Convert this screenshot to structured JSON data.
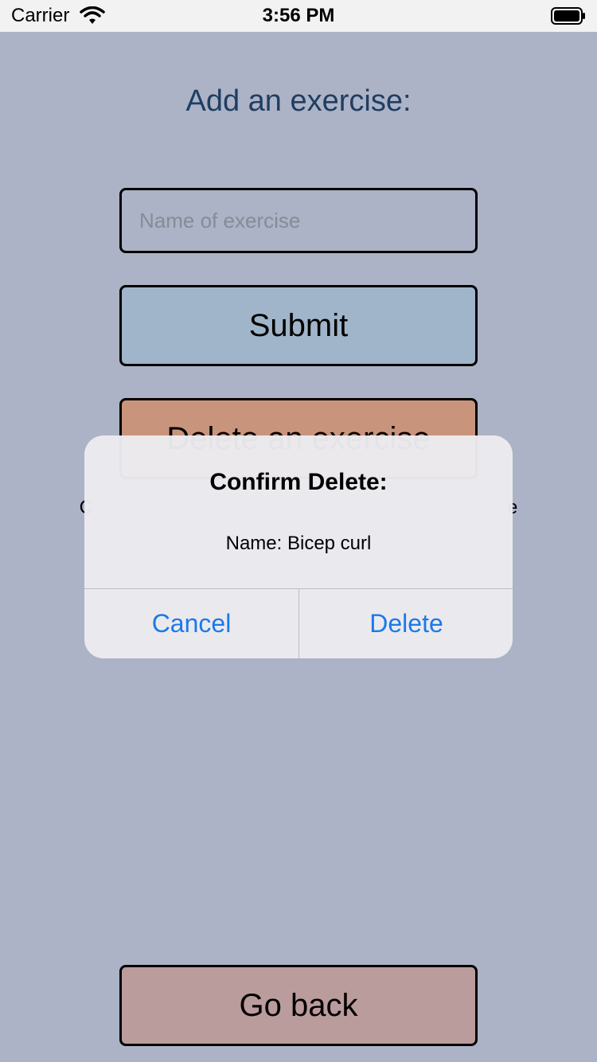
{
  "status_bar": {
    "carrier": "Carrier",
    "time": "3:56 PM",
    "wifi_icon": "wifi-icon",
    "battery_icon": "battery-icon"
  },
  "screen": {
    "title": "Add an exercise:",
    "name_field": {
      "placeholder": "Name of exercise",
      "value": ""
    },
    "submit_label": "Submit",
    "delete_label": "Delete an exercise",
    "partial_text": "C                                                                              e",
    "back_label": "Go back"
  },
  "alert": {
    "title": "Confirm Delete:",
    "message": "Name: Bicep curl",
    "cancel_label": "Cancel",
    "delete_label": "Delete"
  },
  "colors": {
    "background": "#adb3c6",
    "title": "#1f3e63",
    "submit": "#a0b5c9",
    "delete": "#c9947c",
    "back": "#bb9c9d",
    "alert_action": "#1c79e8"
  }
}
